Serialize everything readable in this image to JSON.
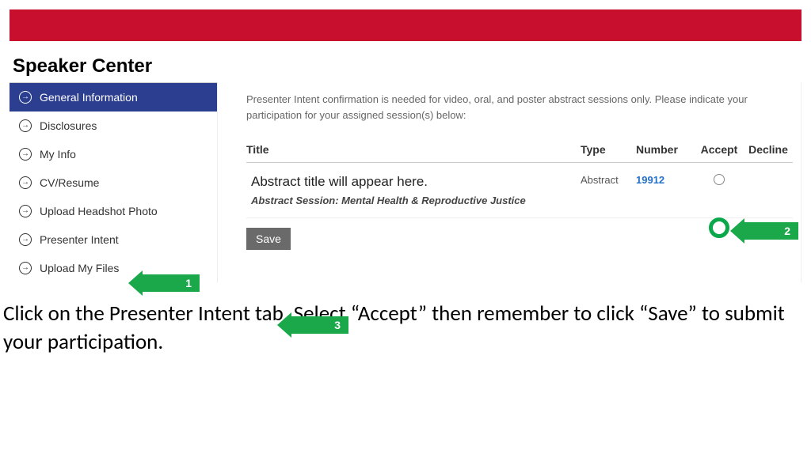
{
  "page_title": "Speaker Center",
  "sidebar": {
    "items": [
      {
        "label": "General Information",
        "active": true
      },
      {
        "label": "Disclosures"
      },
      {
        "label": "My Info"
      },
      {
        "label": "CV/Resume"
      },
      {
        "label": "Upload Headshot Photo"
      },
      {
        "label": "Presenter Intent"
      },
      {
        "label": "Upload My Files"
      }
    ]
  },
  "content": {
    "intro": "Presenter Intent confirmation is needed for video, oral, and poster abstract sessions only. Please indicate your participation for your assigned session(s) below:",
    "headers": {
      "title": "Title",
      "type": "Type",
      "number": "Number",
      "accept": "Accept",
      "decline": "Decline"
    },
    "row": {
      "title": "Abstract title will appear here.",
      "session": "Abstract Session: Mental Health & Reproductive Justice",
      "type": "Abstract",
      "number": "19912"
    },
    "save_label": "Save"
  },
  "callouts": {
    "step1": "1",
    "step2": "2",
    "step3": "3"
  },
  "instruction": "Click on the Presenter Intent tab. Select “Accept” then remember to click  “Save” to submit your participation."
}
